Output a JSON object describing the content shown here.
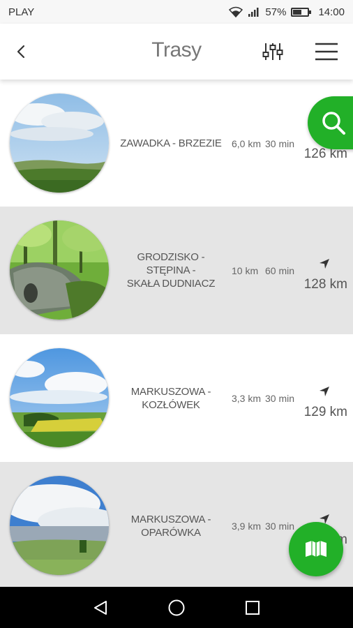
{
  "status_bar": {
    "carrier": "PLAY",
    "battery": "57%",
    "battery_level": 0.57,
    "time": "14:00",
    "icons": [
      "wifi-icon",
      "signal-icon",
      "battery-icon"
    ]
  },
  "app_bar": {
    "title": "Trasy",
    "icons": [
      "back-arrow-icon",
      "sliders-icon",
      "hamburger-menu-icon"
    ]
  },
  "routes": [
    {
      "name_line1": "ZAWADKA - BRZEZIE",
      "name_line2": "",
      "length": "6,0 km",
      "time": "30 min",
      "distance": "126 km",
      "image": "sky-and-hills-photo"
    },
    {
      "name_line1": "GRODZISKO - STĘPINA -",
      "name_line2": "SKAŁA DUDNIACZ",
      "length": "10 km",
      "time": "60 min",
      "distance": "128 km",
      "image": "forest-rock-photo"
    },
    {
      "name_line1": "MARKUSZOWA -",
      "name_line2": "KOZŁÓWEK",
      "length": "3,3 km",
      "time": "30 min",
      "distance": "129 km",
      "image": "meadow-clouds-photo"
    },
    {
      "name_line1": "MARKUSZOWA -",
      "name_line2": "OPARÓWKA",
      "length": "3,9 km",
      "time": "30 min",
      "distance": "m",
      "image": "cloudy-valley-photo"
    }
  ],
  "fabs": {
    "search_icon": "search-icon",
    "map_icon": "open-map-book-icon"
  },
  "colors": {
    "accent": "#22b028",
    "alt_row": "#e5e5e5",
    "text": "#555555"
  },
  "nav_bar": {
    "icons": [
      "back-triangle-icon",
      "home-circle-icon",
      "recents-square-icon"
    ]
  }
}
